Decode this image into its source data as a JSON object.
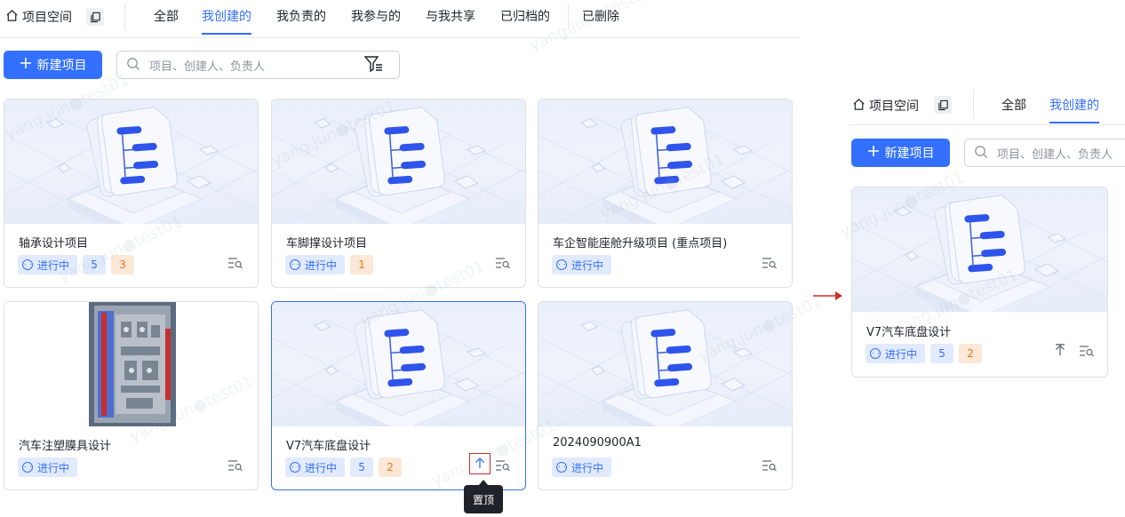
{
  "nav": {
    "space_label": "项目空间",
    "tabs": [
      {
        "label": "全部"
      },
      {
        "label": "我创建的",
        "active": true
      },
      {
        "label": "我负责的"
      },
      {
        "label": "我参与的"
      },
      {
        "label": "与我共享"
      },
      {
        "label": "已归档的"
      },
      {
        "label": "已删除"
      }
    ]
  },
  "toolbar": {
    "new_label": "新建项目",
    "search_placeholder": "项目、创建人、负责人"
  },
  "cards": [
    {
      "title": "轴承设计项目",
      "status": "进行中",
      "count_blue": "5",
      "count_orange": "3"
    },
    {
      "title": "车脚撑设计项目",
      "status": "进行中",
      "count_orange": "1"
    },
    {
      "title": "车企智能座舱升级项目 (重点项目)",
      "status": "进行中"
    },
    {
      "title": "汽车注塑膜具设计",
      "status": "进行中"
    },
    {
      "title": "V7汽车底盘设计",
      "status": "进行中",
      "count_blue": "5",
      "count_orange": "2"
    },
    {
      "title": "2024090900A1",
      "status": "进行中"
    }
  ],
  "tooltip": {
    "label": "置顶"
  },
  "preview": {
    "space_label": "项目空间",
    "tabs": [
      {
        "label": "全部"
      },
      {
        "label": "我创建的",
        "active": true
      }
    ],
    "new_label": "新建项目",
    "search_placeholder": "项目、创建人、负责人",
    "card": {
      "title": "V7汽车底盘设计",
      "status": "进行中",
      "count_blue": "5",
      "count_orange": "2"
    }
  },
  "watermark": "yang.jun●test01",
  "colors": {
    "accent": "#3370ff",
    "orange": "#e8791e",
    "arrow": "#d02b2b"
  }
}
